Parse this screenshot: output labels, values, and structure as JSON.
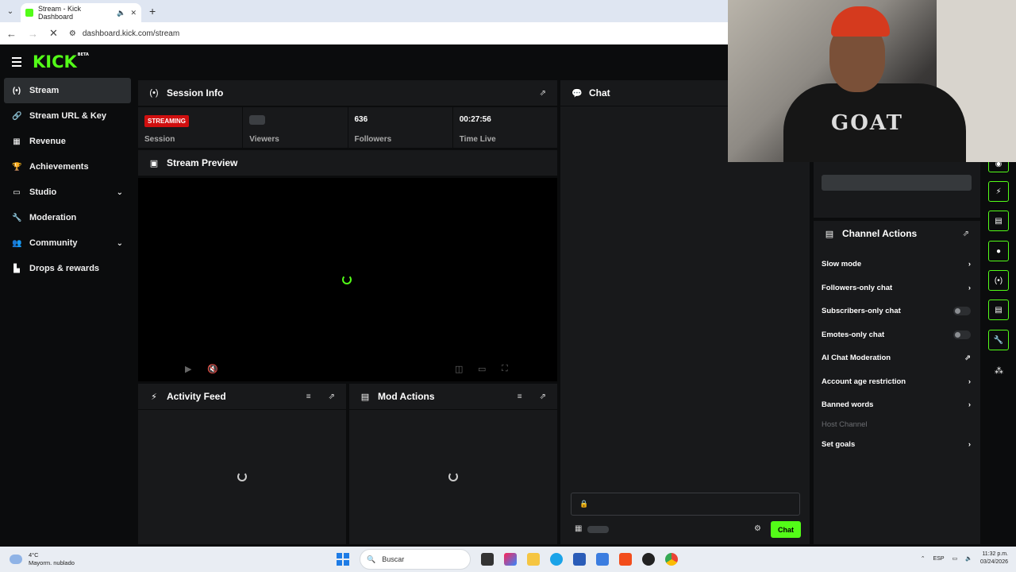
{
  "browser": {
    "tab_title": "Stream - Kick Dashboard",
    "url": "dashboard.kick.com/stream"
  },
  "app": {
    "logo": "KICK",
    "beta": "BETA"
  },
  "sidebar": {
    "items": [
      {
        "label": "Stream",
        "icon": "broadcast-icon"
      },
      {
        "label": "Stream URL & Key",
        "icon": "link-icon"
      },
      {
        "label": "Revenue",
        "icon": "chart-icon"
      },
      {
        "label": "Achievements",
        "icon": "trophy-icon"
      },
      {
        "label": "Studio",
        "icon": "studio-icon"
      },
      {
        "label": "Moderation",
        "icon": "wrench-icon"
      },
      {
        "label": "Community",
        "icon": "people-icon"
      },
      {
        "label": "Drops & rewards",
        "icon": "drops-icon"
      }
    ]
  },
  "session": {
    "title": "Session Info",
    "status_badge": "STREAMING",
    "session_label": "Session",
    "viewers_label": "Viewers",
    "followers_value": "636",
    "followers_label": "Followers",
    "time_value": "00:27:56",
    "time_label": "Time Live"
  },
  "preview": {
    "title": "Stream Preview"
  },
  "activity": {
    "title": "Activity Feed"
  },
  "mod_actions": {
    "title": "Mod Actions"
  },
  "chat": {
    "title": "Chat",
    "send_label": "Chat"
  },
  "channel_actions": {
    "title": "Channel Actions",
    "items": [
      {
        "label": "Slow mode"
      },
      {
        "label": "Followers-only chat"
      },
      {
        "label": "Subscribers-only chat"
      },
      {
        "label": "Emotes-only chat"
      },
      {
        "label": "AI Chat Moderation"
      },
      {
        "label": "Account age restriction"
      },
      {
        "label": "Banned words"
      },
      {
        "label": "Host Channel"
      },
      {
        "label": "Set goals"
      }
    ]
  },
  "webcam": {
    "shirt_text": "GOAT"
  },
  "taskbar": {
    "temperature": "4°C",
    "weather": "Mayorm. nublado",
    "search_placeholder": "Buscar",
    "language": "ESP",
    "time": "11:32 p.m.",
    "date": "03/24/2026"
  },
  "colors": {
    "accent": "#53fc18",
    "live": "#d00f0f",
    "panel": "#18191b",
    "background": "#0b0c0d"
  }
}
